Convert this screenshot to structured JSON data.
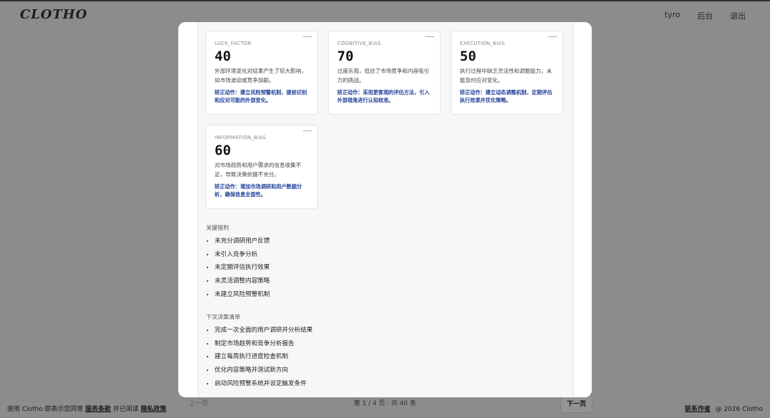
{
  "header": {
    "logo": "CLOTHO",
    "nav": [
      "tyro",
      "后台",
      "退出"
    ]
  },
  "pager": {
    "prev": "上一页",
    "info": "第 1 / 4 页 · 共 40 条",
    "next": "下一页"
  },
  "footer": {
    "left_prefix": "使用 Clotho 即表示您同意",
    "terms": "服务条款",
    "middle": "并已阅读",
    "privacy": "隐私政策",
    "contact": "联系作者",
    "copyright": "@ 2026 Clotho"
  },
  "cards": [
    {
      "key": "LUCK_FACTOR",
      "value": "40",
      "desc": "外部环境变化对结果产生了较大影响，如市场波动或竞争加剧。",
      "fix": "矫正动作：建立风险预警机制，提前识别和应对可能的外部变化。"
    },
    {
      "key": "COGNITIVE_BIAS",
      "value": "70",
      "desc": "过度乐观，低估了市场竞争和内容吸引力的挑战。",
      "fix": "矫正动作：采用更客观的评估方法，引入外部视角进行认知校准。"
    },
    {
      "key": "EXECUTION_BIAS",
      "value": "50",
      "desc": "执行过程中缺乏灵活性和调整能力，未能及时应对变化。",
      "fix": "矫正动作：建立动态调整机制，定期评估执行效果并优化策略。"
    },
    {
      "key": "INFORMATION_BIAS",
      "value": "60",
      "desc": "对市场趋势和用户需求的信息收集不足，导致决策依据不充分。",
      "fix": "矫正动作：增加市场调研和用户数据分析，确保信息全面性。"
    }
  ],
  "key_errors": {
    "title": "关键错判",
    "items": [
      "未充分调研用户反馈",
      "未引入竞争分析",
      "未定期评估执行效果",
      "未灵活调整内容策略",
      "未建立风险预警机制"
    ]
  },
  "next_checklist": {
    "title": "下次决策清单",
    "items": [
      "完成一次全面的用户调研并分析结果",
      "制定市场趋势和竞争分析报告",
      "建立每周执行进度检查机制",
      "优化内容策略并测试新方向",
      "启动风险预警系统并设定触发条件"
    ]
  }
}
